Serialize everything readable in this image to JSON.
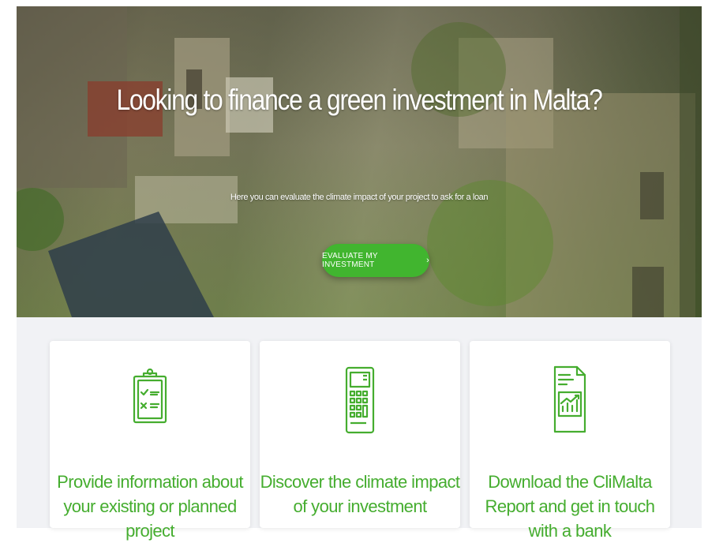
{
  "hero": {
    "title": "Looking to finance a green investment in Malta?",
    "subtitle": "Here you can evaluate the climate impact of your project to ask for a loan",
    "cta_label": "EVALUATE MY INVESTMENT",
    "cta_icon": "chevron-right-icon"
  },
  "steps": [
    {
      "icon": "clipboard-checklist-icon",
      "label": "Provide information about your existing or planned project"
    },
    {
      "icon": "calculator-icon",
      "label": "Discover the climate impact of your investment"
    },
    {
      "icon": "report-chart-icon",
      "label": "Download the CliMalta Report and get in touch with a bank"
    }
  ],
  "colors": {
    "accent": "#41b52f",
    "text_green": "#45ad2f",
    "section_bg": "#f1f2f5"
  }
}
